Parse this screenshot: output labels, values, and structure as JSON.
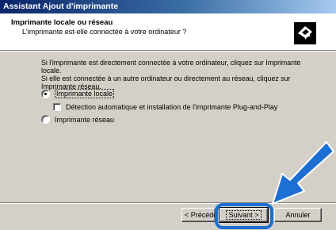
{
  "window": {
    "title": "Assistant Ajout d'imprimante"
  },
  "header": {
    "title": "Imprimante locale ou réseau",
    "subtitle": "L'imprimante est-elle connectée à votre ordinateur ?",
    "icon": "printer-wizard-icon"
  },
  "body": {
    "description_lines": [
      "Si l'imprimante est directement connectée à votre ordinateur, cliquez sur Imprimante locale.",
      "Si elle est connectée à un autre ordinateur ou directement au réseau, cliquez sur",
      "Imprimante réseau."
    ],
    "options": [
      {
        "label": "Imprimante locale",
        "selected": true
      },
      {
        "label": "Imprimante réseau",
        "selected": false
      }
    ],
    "checkbox": {
      "label": "Détection automatique et installation de l'imprimante Plug-and-Play",
      "checked": false
    }
  },
  "footer": {
    "back_label": "< Précéde",
    "next_label": "Suivant >",
    "cancel_label": "Annuler"
  },
  "annotation": {
    "color": "#1d6fd4",
    "arrow_icon": "pointer-arrow-icon"
  }
}
